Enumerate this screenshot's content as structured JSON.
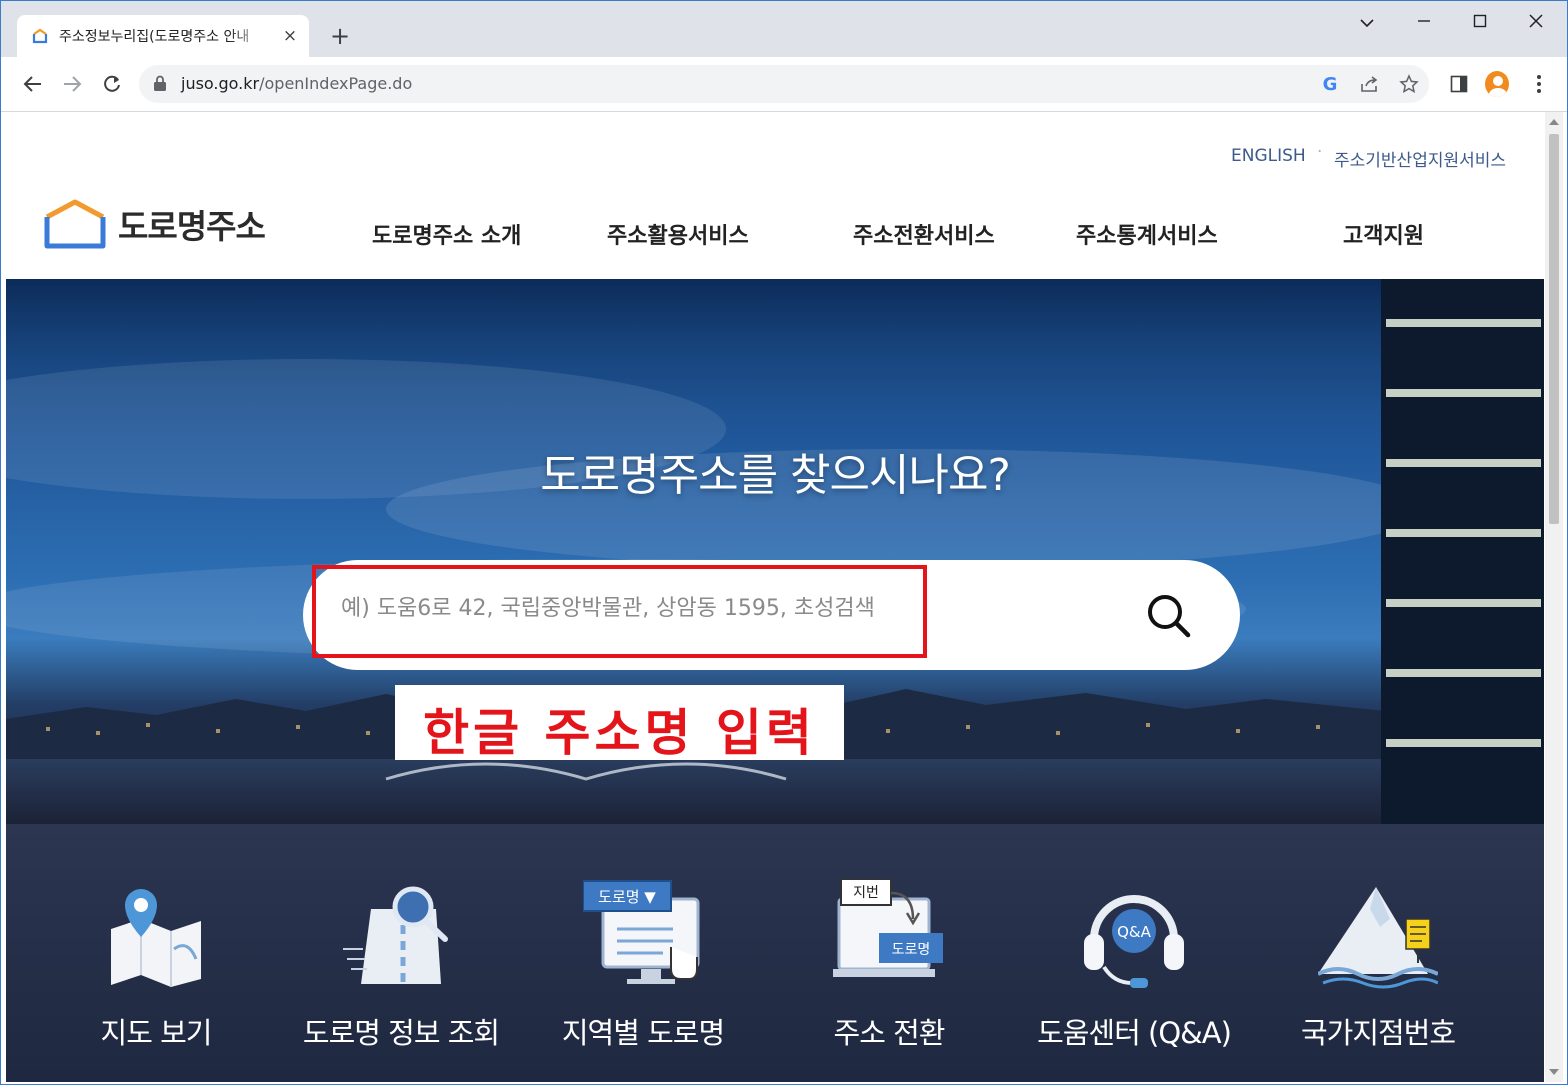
{
  "browser": {
    "tab_title": "주소정보누리집(도로명주소 안내",
    "tab_close": "×",
    "new_tab": "+",
    "url_host": "juso.go.kr",
    "url_path": "/openIndexPage.do"
  },
  "header": {
    "util_links": [
      "ENGLISH",
      "주소기반산업지원서비스"
    ],
    "util_sep": "·",
    "logo_text": "도로명주소",
    "nav": [
      "도로명주소 소개",
      "주소활용서비스",
      "주소전환서비스",
      "주소통계서비스",
      "고객지원"
    ]
  },
  "hero": {
    "title": "도로명주소를 찾으시나요?",
    "search_placeholder": "예) 도움6로 42, 국립중앙박물관, 상암동 1595, 초성검색",
    "search_value": "",
    "callout": "한글 주소명 입력",
    "highlight_color": "#e4141b"
  },
  "quick_menu": {
    "items": [
      {
        "label": "지도 보기",
        "icon": "map-icon"
      },
      {
        "label": "도로명 정보 조회",
        "icon": "road-search-icon"
      },
      {
        "label": "지역별 도로명",
        "icon": "regional-road-icon",
        "badge": "도로명 ▼"
      },
      {
        "label": "주소 전환",
        "icon": "address-convert-icon",
        "badge_top": "지번",
        "badge_bottom": "도로명"
      },
      {
        "label": "도움센터 (Q&A)",
        "icon": "help-center-icon",
        "badge": "Q&A"
      },
      {
        "label": "국가지점번호",
        "icon": "national-point-icon"
      }
    ]
  },
  "colors": {
    "accent": "#e4141b",
    "logo_orange": "#f29a2e",
    "logo_blue": "#3b7bd8",
    "nav_text": "#222222",
    "util_text": "#3d5a8a"
  }
}
